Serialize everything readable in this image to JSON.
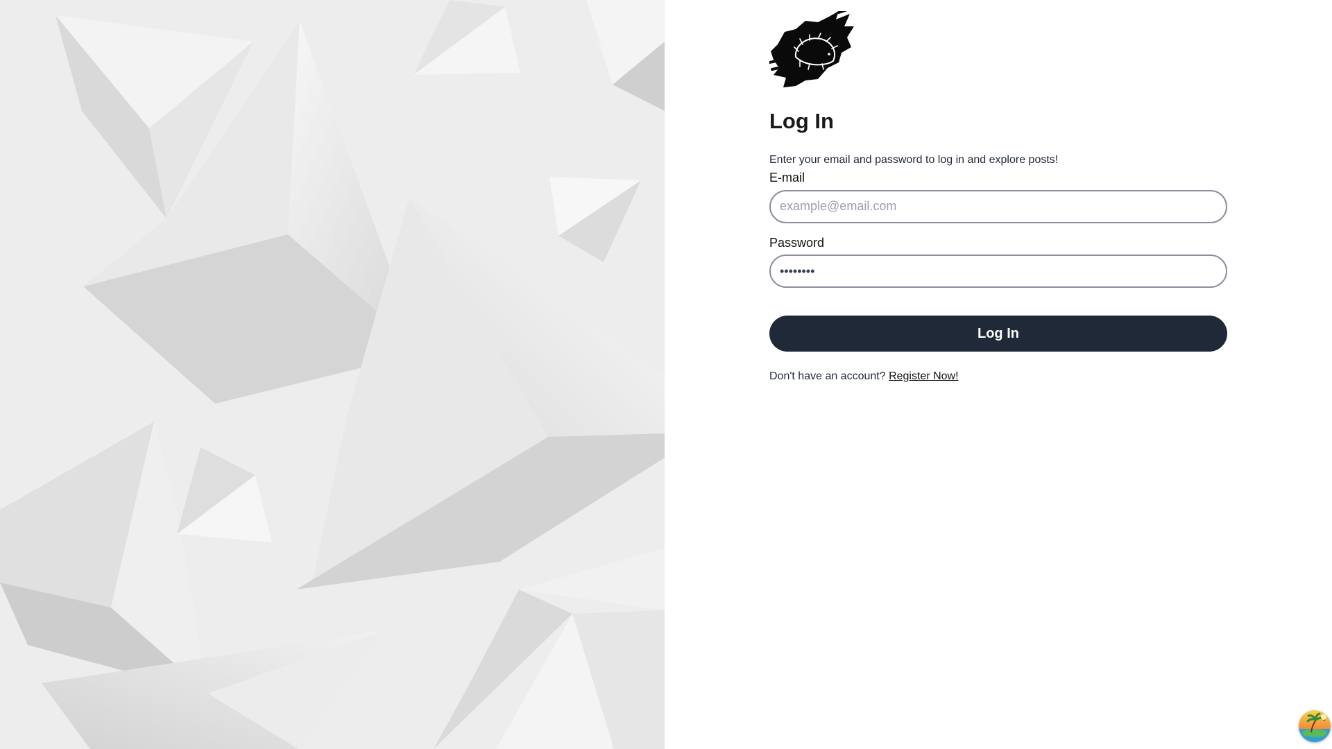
{
  "login": {
    "title": "Log In",
    "subtitle": "Enter your email and password to log in and explore posts!",
    "email_label": "E-mail",
    "email_placeholder": "example@email.com",
    "password_label": "Password",
    "password_value": "••••••••",
    "submit_label": "Log In",
    "register_prompt": "Don't have an account?",
    "register_link": "Register Now!"
  },
  "icons": {
    "logo": "hedgehog-logo-icon",
    "corner_badge": "island-avatar-icon"
  },
  "colors": {
    "button_bg": "#1f2937",
    "button_text": "#ffffff",
    "input_border": "#8b8f9a",
    "art_background": "#ececec"
  }
}
